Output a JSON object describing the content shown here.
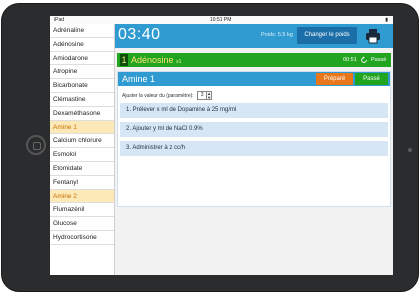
{
  "statusbar": {
    "carrier": "iPad",
    "time": "10:51 PM"
  },
  "sidebar": {
    "items": [
      {
        "label": "Adrénaline",
        "highlight": false
      },
      {
        "label": "Adénosine",
        "highlight": false
      },
      {
        "label": "Amiodarone",
        "highlight": false
      },
      {
        "label": "Atropine",
        "highlight": false
      },
      {
        "label": "Bicarbonate",
        "highlight": false
      },
      {
        "label": "Clémastine",
        "highlight": false
      },
      {
        "label": "Dexaméthasone",
        "highlight": false
      },
      {
        "label": "Amine 1",
        "highlight": true
      },
      {
        "label": "Calcium chlorure",
        "highlight": false
      },
      {
        "label": "Esmolol",
        "highlight": false
      },
      {
        "label": "Etomidate",
        "highlight": false
      },
      {
        "label": "Fentanyl",
        "highlight": false
      },
      {
        "label": "Amine 2",
        "highlight": true
      },
      {
        "label": "Flumazénil",
        "highlight": false
      },
      {
        "label": "Glucose",
        "highlight": false
      },
      {
        "label": "Hydrocortisone",
        "highlight": false
      }
    ]
  },
  "topbar": {
    "timer": "03:40",
    "weight_label": "Poids: 5.5 kg",
    "change_weight_label": "Changer le poids",
    "print_icon": "printer-icon"
  },
  "active_drug": {
    "number": "1",
    "name": "Adénosine",
    "multiplier": "x1",
    "elapsed": "00:51",
    "refresh_icon": "refresh-icon",
    "status": "Passé"
  },
  "amine": {
    "title": "Amine 1",
    "prepare_label": "Préparé",
    "passe_label": "Passé",
    "param_label": "Ajuster la valeur du (paramètre):",
    "param_value": "3",
    "steps": [
      "1. Prélever x ml de Dopamine à 25 mg/ml",
      "2. Ajouter y ml de NaCl 0.9%",
      "3. Administrer à z cc/h"
    ]
  },
  "colors": {
    "topbar": "#2f9bd1",
    "green": "#21a41f",
    "orange": "#e8761a",
    "highlight": "#fde9b7"
  }
}
